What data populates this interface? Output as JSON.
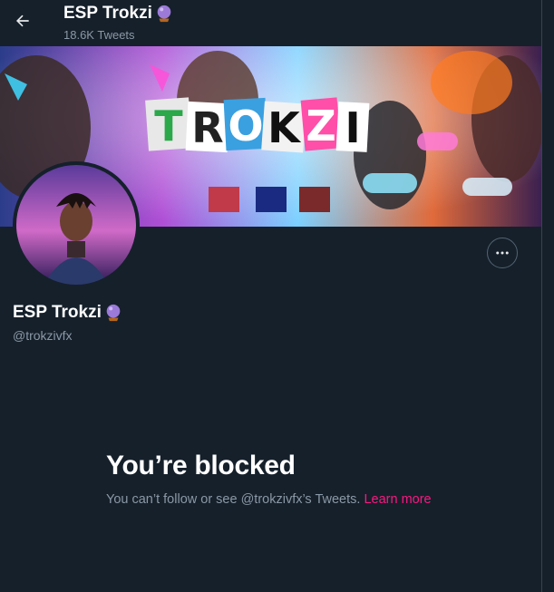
{
  "header": {
    "display_name": "ESP Trokzi",
    "tweet_count": "18.6K Tweets",
    "back_icon": "arrow-left-icon",
    "name_emoji": "crystal-ball-icon"
  },
  "banner": {
    "wordmark": "TROKZI"
  },
  "profile": {
    "display_name": "ESP Trokzi",
    "handle": "@trokzivfx",
    "more_icon": "ellipsis-icon"
  },
  "blocked": {
    "title": "You’re blocked",
    "message": "You can’t follow or see @trokzivfx’s Tweets.",
    "link_label": "Learn more"
  },
  "colors": {
    "background": "#15202b",
    "secondary_text": "#8b98a5",
    "link": "#f91880",
    "border": "#536471"
  }
}
